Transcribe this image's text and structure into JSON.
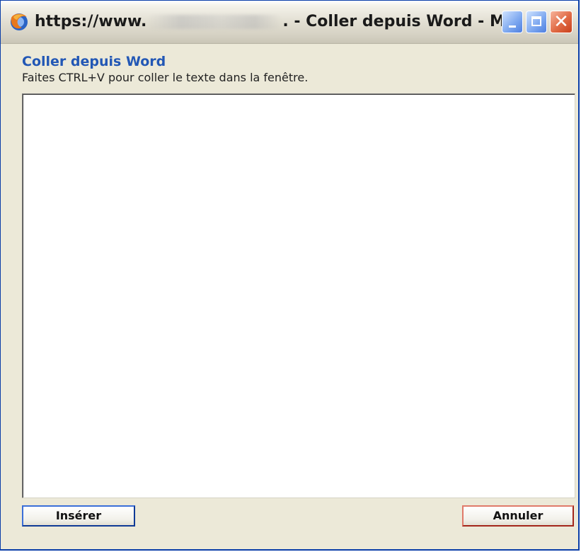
{
  "window": {
    "title_prefix": "https://www.",
    "title_suffix": ". - Coller depuis Word - M..."
  },
  "dialog": {
    "heading": "Coller depuis Word",
    "instructions": "Faites CTRL+V pour coller le texte dans la fenêtre.",
    "paste_value": ""
  },
  "buttons": {
    "insert_label": "Insérer",
    "cancel_label": "Annuler"
  },
  "icons": {
    "app": "firefox-icon",
    "minimize": "minimize-icon",
    "maximize": "maximize-icon",
    "close": "close-icon"
  },
  "colors": {
    "heading": "#2257b5",
    "title_bar": "#d6d2c4",
    "close_button": "#c9401b",
    "window_buttons": "#4e7fe0"
  }
}
